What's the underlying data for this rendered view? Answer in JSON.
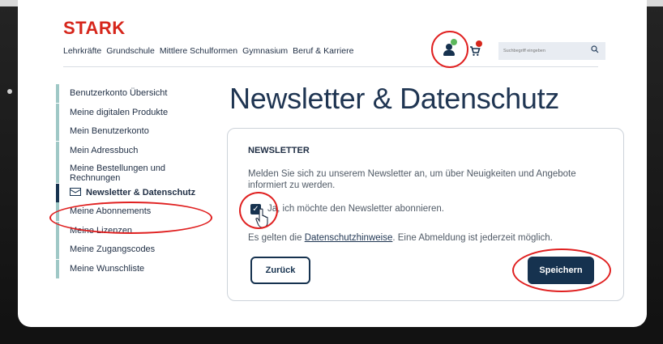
{
  "header": {
    "logo": "STARK",
    "nav": [
      "Lehrkräfte",
      "Grundschule",
      "Mittlere Schulformen",
      "Gymnasium",
      "Beruf & Karriere"
    ],
    "search_placeholder": "Suchbegriff eingeben",
    "icons": {
      "account": "user-icon",
      "cart": "cart-icon",
      "search": "search-icon"
    },
    "badge_colors": {
      "account": "#5cb85c",
      "cart": "#d6261b"
    }
  },
  "sidebar": {
    "items": [
      {
        "label": "Benutzerkonto Übersicht"
      },
      {
        "label": "Meine digitalen Produkte"
      },
      {
        "label": "Mein Benutzerkonto"
      },
      {
        "label": "Mein Adressbuch"
      },
      {
        "label": "Meine Bestellungen und Rechnungen"
      },
      {
        "label": "Newsletter & Datenschutz",
        "active": true
      },
      {
        "label": "Meine Abonnements"
      },
      {
        "label": "Meine Lizenzen"
      },
      {
        "label": "Meine Zugangscodes"
      },
      {
        "label": "Meine Wunschliste"
      }
    ]
  },
  "main": {
    "title": "Newsletter & Datenschutz",
    "newsletter": {
      "heading": "NEWSLETTER",
      "description": "Melden Sie sich zu unserem Newsletter an, um über Neuigkeiten und Angebote informiert zu werden.",
      "checkbox_label": "Ja, ich möchte den Newsletter abonnieren.",
      "checkbox_checked": true,
      "privacy_prefix": "Es gelten die ",
      "privacy_link": "Datenschutzhinweise",
      "privacy_suffix": ". Eine Abmeldung ist jederzeit möglich.",
      "back_label": "Zurück",
      "save_label": "Speichern"
    }
  },
  "colors": {
    "brand_red": "#d6261b",
    "navy": "#16324f",
    "sidebar_accent": "#9fc8c6",
    "highlight": "#e02020"
  }
}
